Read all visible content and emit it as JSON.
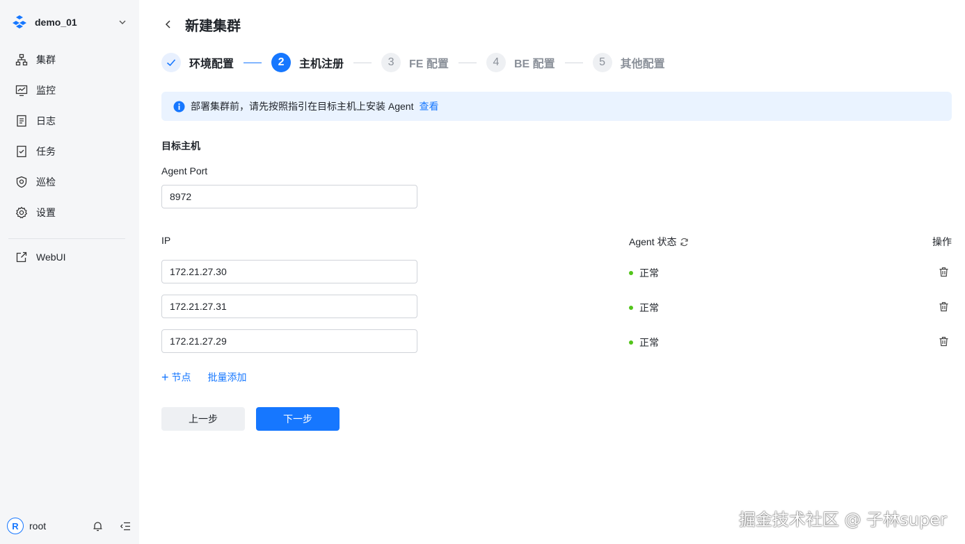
{
  "sidebar": {
    "workspace": "demo_01",
    "items": [
      {
        "label": "集群",
        "icon": "cluster-icon"
      },
      {
        "label": "监控",
        "icon": "monitor-icon"
      },
      {
        "label": "日志",
        "icon": "log-icon"
      },
      {
        "label": "任务",
        "icon": "task-icon"
      },
      {
        "label": "巡检",
        "icon": "inspect-icon"
      },
      {
        "label": "设置",
        "icon": "settings-icon"
      }
    ],
    "webui": {
      "label": "WebUI",
      "icon": "external-link-icon"
    },
    "user": {
      "initial": "R",
      "name": "root"
    }
  },
  "header": {
    "title": "新建集群"
  },
  "steps": [
    {
      "number": "1",
      "label": "环境配置",
      "state": "done"
    },
    {
      "number": "2",
      "label": "主机注册",
      "state": "active"
    },
    {
      "number": "3",
      "label": "FE 配置",
      "state": "wait"
    },
    {
      "number": "4",
      "label": "BE 配置",
      "state": "wait"
    },
    {
      "number": "5",
      "label": "其他配置",
      "state": "wait"
    }
  ],
  "alert": {
    "text": "部署集群前，请先按照指引在目标主机上安装 Agent",
    "link": "查看"
  },
  "form": {
    "section_title": "目标主机",
    "agent_port_label": "Agent Port",
    "agent_port_value": "8972",
    "columns": {
      "ip": "IP",
      "agent_status": "Agent 状态",
      "action": "操作"
    },
    "hosts": [
      {
        "ip": "172.21.27.30",
        "status": "正常"
      },
      {
        "ip": "172.21.27.31",
        "status": "正常"
      },
      {
        "ip": "172.21.27.29",
        "status": "正常"
      }
    ],
    "add_node": "节点",
    "batch_add": "批量添加"
  },
  "buttons": {
    "prev": "上一步",
    "next": "下一步"
  },
  "watermark": "掘金技术社区 @ 子林super",
  "colors": {
    "primary": "#1677ff",
    "success": "#52c41a",
    "sidebar_bg": "#f5f6f8",
    "alert_bg": "#eaf3ff"
  }
}
